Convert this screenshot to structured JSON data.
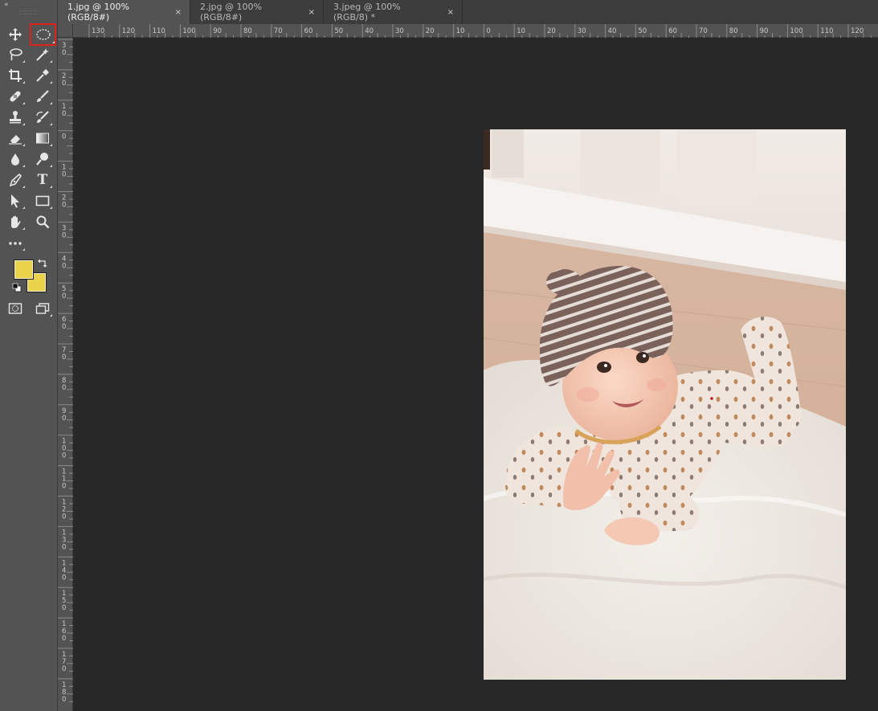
{
  "tabs": [
    {
      "label": "1.jpg @ 100% (RGB/8#)",
      "active": true
    },
    {
      "label": "2.jpg @ 100% (RGB/8#)",
      "active": false
    },
    {
      "label": "3.jpeg @ 100% (RGB/8) *",
      "active": false
    }
  ],
  "tab_close_glyph": "×",
  "toolbar": {
    "collapse_glyph": "«",
    "tools": [
      {
        "name": "move-tool",
        "icon": "move-icon"
      },
      {
        "name": "elliptical-marquee-tool",
        "icon": "ellipse-marquee-icon",
        "selected": true
      },
      {
        "name": "lasso-tool",
        "icon": "lasso-icon"
      },
      {
        "name": "magic-wand-tool",
        "icon": "magic-wand-icon"
      },
      {
        "name": "crop-tool",
        "icon": "crop-icon"
      },
      {
        "name": "eyedropper-tool",
        "icon": "eyedropper-icon"
      },
      {
        "name": "healing-brush-tool",
        "icon": "bandage-icon"
      },
      {
        "name": "brush-tool",
        "icon": "brush-icon"
      },
      {
        "name": "clone-stamp-tool",
        "icon": "stamp-icon"
      },
      {
        "name": "history-brush-tool",
        "icon": "history-brush-icon"
      },
      {
        "name": "eraser-tool",
        "icon": "eraser-icon"
      },
      {
        "name": "gradient-tool",
        "icon": "gradient-icon"
      },
      {
        "name": "blur-tool",
        "icon": "blur-drop-icon"
      },
      {
        "name": "dodge-tool",
        "icon": "dodge-icon"
      },
      {
        "name": "pen-tool",
        "icon": "pen-icon"
      },
      {
        "name": "type-tool",
        "icon": "type-icon",
        "label": "T"
      },
      {
        "name": "path-selection-tool",
        "icon": "arrow-pointer-icon"
      },
      {
        "name": "rectangle-tool",
        "icon": "rectangle-icon"
      },
      {
        "name": "hand-tool",
        "icon": "hand-icon"
      },
      {
        "name": "zoom-tool",
        "icon": "zoom-icon"
      },
      {
        "name": "edit-toolbar",
        "icon": "more-dots-icon"
      }
    ],
    "foreground_color": "#e8d34a",
    "background_color": "#e8d34a"
  },
  "ruler": {
    "horizontal_labels": [
      "130",
      "120",
      "110",
      "100",
      "90",
      "80",
      "70",
      "60",
      "50",
      "40",
      "30",
      "20",
      "10",
      "0",
      "10",
      "20",
      "30",
      "40",
      "50",
      "60",
      "70",
      "80",
      "90",
      "100",
      "110",
      "120"
    ],
    "vertical_labels": [
      "3 0",
      "2 0",
      "1 0",
      "0",
      "1 0",
      "2 0",
      "3 0",
      "4 0",
      "5 0",
      "6 0",
      "7 0",
      "8 0",
      "9 0",
      "1 0 0",
      "1 1 0",
      "1 2 0",
      "1 3 0",
      "1 4 0",
      "1 5 0",
      "1 6 0",
      "1 7 0",
      "1 8 0"
    ]
  },
  "document": {
    "image_subject": "baby in striped hat lying on white fur rug"
  },
  "colors": {
    "panel": "#535353",
    "canvas": "#282828",
    "selection_highlight": "#e0201f",
    "swatch": "#e8d34a"
  }
}
